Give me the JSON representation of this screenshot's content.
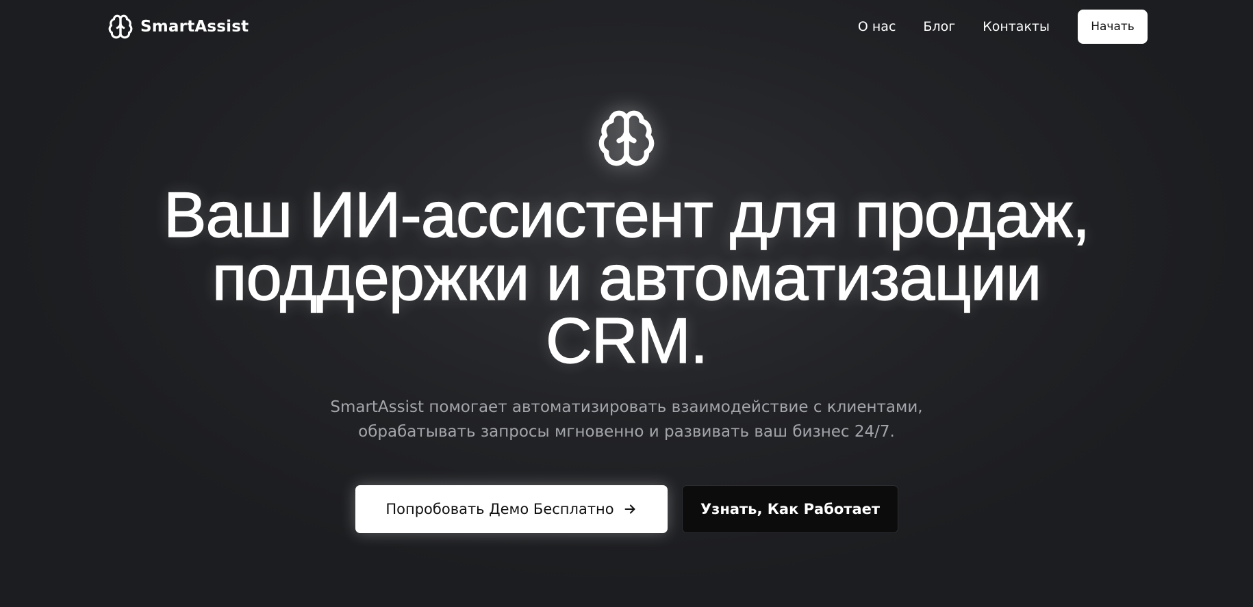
{
  "header": {
    "brand_name": "SmartAssist",
    "brand_icon": "brain-icon",
    "nav": [
      {
        "label": "О нас"
      },
      {
        "label": "Блог"
      },
      {
        "label": "Контакты"
      }
    ],
    "start_label": "Начать"
  },
  "hero": {
    "icon": "brain-icon",
    "headline_lines": [
      "Ваш ИИ-ассистент для продаж,",
      "поддержки и автоматизации",
      "CRM."
    ],
    "subtitle_lines": [
      "SmartAssist помогает автоматизировать взаимодействие с клиентами,",
      "обрабатывать запросы мгновенно и развивать ваш бизнес 24/7."
    ],
    "primary_cta": "Попробовать Демо Бесплатно",
    "primary_cta_icon": "arrow-right-icon",
    "secondary_cta": "Узнать, Как Работает"
  },
  "colors": {
    "background": "#222326",
    "text": "#ffffff",
    "subtitle": "#a3a5ab",
    "button_light": "#ffffff",
    "button_dark": "#0c0c0d"
  }
}
